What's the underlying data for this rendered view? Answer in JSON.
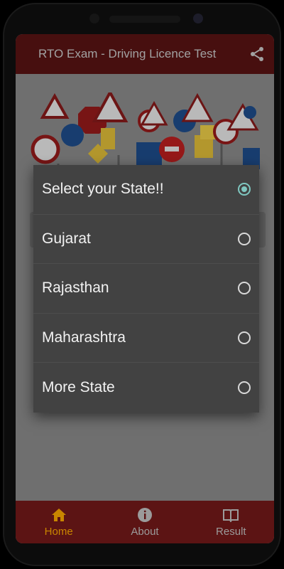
{
  "app": {
    "title": "RTO Exam - Driving Licence Test",
    "share_icon": "share-icon"
  },
  "dialog": {
    "options": [
      {
        "label": "Select your State!!",
        "selected": true
      },
      {
        "label": "Gujarat",
        "selected": false
      },
      {
        "label": "Rajasthan",
        "selected": false
      },
      {
        "label": "Maharashtra",
        "selected": false
      },
      {
        "label": "More State",
        "selected": false
      }
    ]
  },
  "bottom_nav": {
    "items": [
      {
        "label": "Home",
        "icon": "home-icon",
        "active": true
      },
      {
        "label": "About",
        "icon": "info-icon",
        "active": false
      },
      {
        "label": "Result",
        "icon": "book-icon",
        "active": false
      }
    ]
  },
  "colors": {
    "appbar": "#5c1414",
    "accent": "#7fc7c0",
    "active_nav": "#c98600",
    "dialog_bg": "#424242"
  }
}
